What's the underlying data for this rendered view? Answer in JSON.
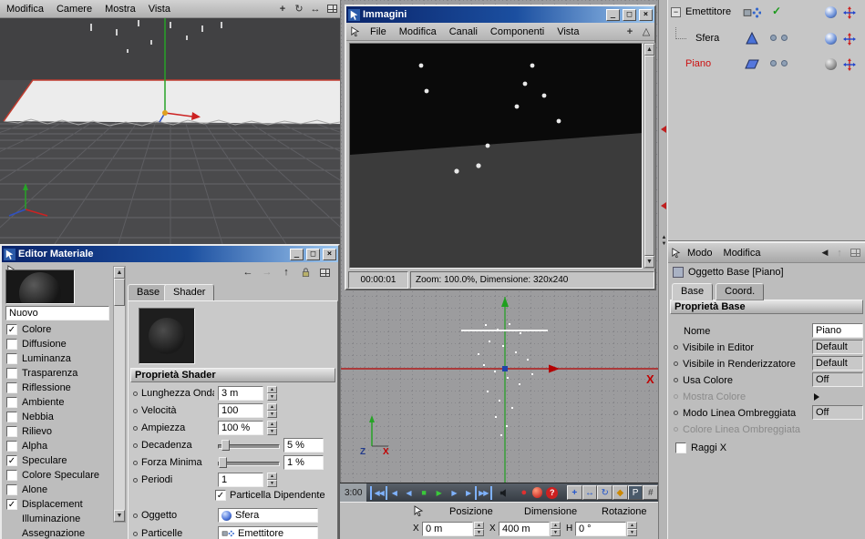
{
  "viewport_top": {
    "menu": [
      {
        "label": "Modifica"
      },
      {
        "label": "Camere"
      },
      {
        "label": "Mostra"
      },
      {
        "label": "Vista"
      }
    ]
  },
  "material_editor": {
    "title": "Editor Materiale",
    "name_value": "Nuovo",
    "channels": [
      {
        "label": "Colore",
        "mark": "✓"
      },
      {
        "label": "Diffusione",
        "mark": ""
      },
      {
        "label": "Luminanza",
        "mark": ""
      },
      {
        "label": "Trasparenza",
        "mark": ""
      },
      {
        "label": "Riflessione",
        "mark": ""
      },
      {
        "label": "Ambiente",
        "mark": ""
      },
      {
        "label": "Nebbia",
        "mark": ""
      },
      {
        "label": "Rilievo",
        "mark": ""
      },
      {
        "label": "Alpha",
        "mark": ""
      },
      {
        "label": "Speculare",
        "mark": "✓"
      },
      {
        "label": "Colore Speculare",
        "mark": ""
      },
      {
        "label": "Alone",
        "mark": ""
      },
      {
        "label": "Displacement",
        "mark": "✓"
      },
      {
        "label": "Illuminazione"
      },
      {
        "label": "Assegnazione"
      }
    ],
    "tabs": {
      "base": "Base",
      "shader": "Shader"
    },
    "section_title": "Proprietà Shader",
    "params": {
      "wave": {
        "label": "Lunghezza Onda",
        "value": "3 m"
      },
      "speed": {
        "label": "Velocità",
        "value": "100"
      },
      "amp": {
        "label": "Ampiezza",
        "value": "100 %"
      },
      "decay": {
        "label": "Decadenza",
        "value": "5 %"
      },
      "minforce": {
        "label": "Forza Minima",
        "value": "1 %"
      },
      "periods": {
        "label": "Periodi",
        "value": "1"
      }
    },
    "particle_dependent": {
      "label": "Particella Dipendente",
      "mark": "✓"
    },
    "object_row": {
      "label": "Oggetto",
      "value": "Sfera"
    },
    "particles_row": {
      "label": "Particelle",
      "value": "Emettitore"
    }
  },
  "images_window": {
    "title": "Immagini",
    "menu": [
      {
        "label": "File"
      },
      {
        "label": "Modifica"
      },
      {
        "label": "Canali"
      },
      {
        "label": "Componenti"
      },
      {
        "label": "Vista"
      }
    ],
    "status_time": "00:00:01",
    "status_info": "Zoom: 100.0%, Dimensione: 320x240"
  },
  "front_viewport": {
    "x_axis_label": "X",
    "axis_gizmo": {
      "z": "Z",
      "x": "X"
    }
  },
  "timeline": {
    "time_label": "3:00",
    "help_glyph": "?",
    "record_point_glyph": "P"
  },
  "coords_panel": {
    "headers": [
      {
        "label": "Posizione"
      },
      {
        "label": "Dimensione"
      },
      {
        "label": "Rotazione"
      }
    ],
    "fields": [
      {
        "label": "X",
        "value": "0 m"
      },
      {
        "label": "X",
        "value": "400 m"
      },
      {
        "label": "H",
        "value": "0 °"
      }
    ]
  },
  "object_manager": {
    "items": [
      {
        "label": "Emettitore"
      },
      {
        "label": "Sfera"
      },
      {
        "label": "Piano"
      }
    ]
  },
  "attribute_manager": {
    "menu": {
      "modo": "Modo",
      "modifica": "Modifica"
    },
    "object_title": "Oggetto Base [Piano]",
    "tabs": {
      "base": "Base",
      "coord": "Coord."
    },
    "section_title": "Proprietà Base",
    "rows": {
      "nome": {
        "label": "Nome",
        "value": "Piano"
      },
      "vis_editor": {
        "label": "Visibile in Editor",
        "value": "Default"
      },
      "vis_render": {
        "label": "Visibile in Renderizzatore",
        "value": "Default"
      },
      "usa_colore": {
        "label": "Usa Colore",
        "value": "Off"
      },
      "mostra_colore": {
        "label": "Mostra Colore"
      },
      "modo_linea": {
        "label": "Modo Linea Ombreggiata",
        "value": "Off"
      },
      "colore_linea": {
        "label": "Colore Linea Ombreggiata"
      },
      "raggi_x": {
        "label": "Raggi X",
        "mark": ""
      }
    }
  }
}
